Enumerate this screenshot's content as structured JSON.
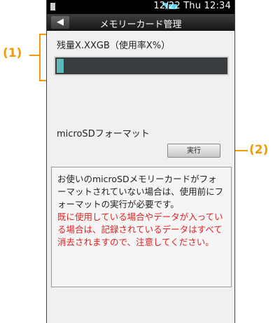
{
  "statusbar": {
    "time": "12/22 Thu 12:34",
    "icons": [
      "wifi-icon",
      "battery-icon"
    ]
  },
  "header": {
    "back_icon": "back-arrow-icon",
    "title": "メモリーカード管理"
  },
  "storage": {
    "label": "残量X.XXGB（使用率X%）",
    "usage_percent": 4
  },
  "format": {
    "label": "microSDフォーマット",
    "execute_label": "実行"
  },
  "notice": {
    "normal": "お使いのmicroSDメモリーカードがフォーマットされていない場合は、使用前にフォーマットの実行が必要です。",
    "warning": "既に使用している場合やデータが入っている場合は、記録されているデータはすべて消去されますので、注意してください。"
  },
  "callouts": {
    "c1": "(1)",
    "c2": "(2)"
  },
  "colors": {
    "accent": "#f29a00",
    "warning": "#e02020",
    "bar_fill": "#5fb8b8",
    "bar_bg": "#3a3d40"
  }
}
